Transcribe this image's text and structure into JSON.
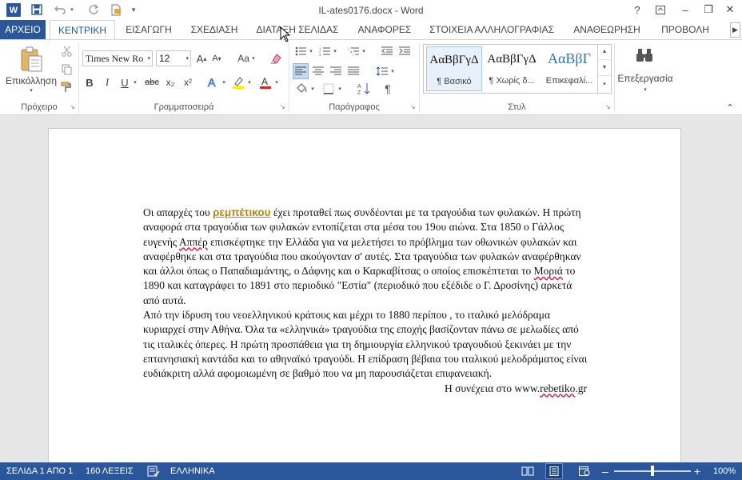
{
  "window": {
    "app_icon": "W",
    "title": "IL-ates0176.docx - Word",
    "help": "?",
    "minimize": "–",
    "maximize": "❐",
    "close": "✕"
  },
  "qat": {
    "save_icon": "save-icon",
    "undo_icon": "undo-icon",
    "redo_icon": "redo-icon"
  },
  "tabs": [
    {
      "label": "ΑΡΧΕΙΟ"
    },
    {
      "label": "ΚΕΝΤΡΙΚΗ"
    },
    {
      "label": "ΕΙΣΑΓΩΓΗ"
    },
    {
      "label": "ΣΧΕΔΙΑΣΗ"
    },
    {
      "label": "ΔΙΑΤΑΞΗ ΣΕΛΙΔΑΣ"
    },
    {
      "label": "ΑΝΑΦΟΡΕΣ"
    },
    {
      "label": "ΣΤΟΙΧΕΙΑ ΑΛΛΗΛΟΓΡΑΦΙΑΣ"
    },
    {
      "label": "ΑΝΑΘΕΩΡΗΣΗ"
    },
    {
      "label": "ΠΡΟΒΟΛΗ"
    }
  ],
  "ribbon": {
    "clipboard": {
      "paste_label": "Επικόλληση",
      "group_label": "Πρόχειρο"
    },
    "font": {
      "font_name": "Times New Ro",
      "font_size": "12",
      "group_label": "Γραμματοσειρά",
      "bold": "B",
      "italic": "I",
      "underline": "U",
      "strike": "abc",
      "subscript": "x₂",
      "superscript": "x²",
      "grow": "A",
      "shrink": "A",
      "case": "Aa"
    },
    "paragraph": {
      "group_label": "Παράγραφος"
    },
    "styles": {
      "group_label": "Στυλ",
      "items": [
        {
          "sample": "ΑαΒβΓγΔ",
          "name": "¶ Βασικό"
        },
        {
          "sample": "ΑαΒβΓγΔ",
          "name": "¶ Χωρίς δ..."
        },
        {
          "sample": "ΑαΒβΓ",
          "name": "Επικεφαλί..."
        }
      ]
    },
    "editing": {
      "label": "Επεξεργασία"
    }
  },
  "document": {
    "p1_before": "Οι απαρχές του ",
    "p1_link": "ρεμπέτικου",
    "p1_after_a": " έχει προταθεί πως συνδέονται με τα τραγούδια των φυλακών. Η πρώτη αναφορά στα τραγούδια των φυλακών εντοπίζεται στα μέσα του 19ου αιώνα. Στα 1850 ο Γάλλος ευγενής ",
    "p1_name": "Αππέρ",
    "p1_after_b": " επισκέφτηκε την Ελλάδα για να μελετήσει το πρόβλημα των οθωνικών φυλακών και αναφέρθηκε και στα τραγούδια που ακούγονταν σ' αυτές. Στα τραγούδια των φυλακών αναφέρθηκαν και άλλοι όπως ο Παπαδιαμάντης, ο Δάφνης και ο Καρκαβίτσας ο οποίος επισκέπτεται  το ",
    "p1_place": "Μοριά",
    "p1_after_c": " το 1890 και καταγράφει το 1891 στο περιοδικό  \"Εστία\" (περιοδικό που εξέδιδε ο Γ. Δροσίνης) αρκετά από αυτά.",
    "p2": "Από την ίδρυση του νεοελληνικού κράτους και μέχρι το 1880 περίπου , το ιταλικό μελόδραμα κυριαρχεί στην Αθήνα.  Όλα τα «ελληνικά» τραγούδια της εποχής βασίζονταν πάνω σε μελωδίες από τις ιταλικές όπερες. Η πρώτη προσπάθεια για τη δημιουργία ελληνικού τραγουδιού ξεκινάει με την επτανησιακή καντάδα και το αθηναϊκό τραγούδι. Η επίδραση βέβαια του ιταλικού μελοδράματος είναι ευδιάκριτη αλλά αφομοιωμένη σε βαθμό που να μη παρουσιάζεται επιφανειακή.",
    "continue_before": "Η συνέχεια στο   www.",
    "continue_link": "rebetiko",
    "continue_after": ".gr"
  },
  "status": {
    "page": "ΣΕΛΙΔΑ 1 ΑΠΟ 1",
    "words": "160 ΛΕΞΕΙΣ",
    "language": "ΕΛΛΗΝΙΚΑ",
    "zoom_minus": "–",
    "zoom_plus": "+",
    "zoom": "100%"
  },
  "colors": {
    "accent": "#2b579a"
  }
}
